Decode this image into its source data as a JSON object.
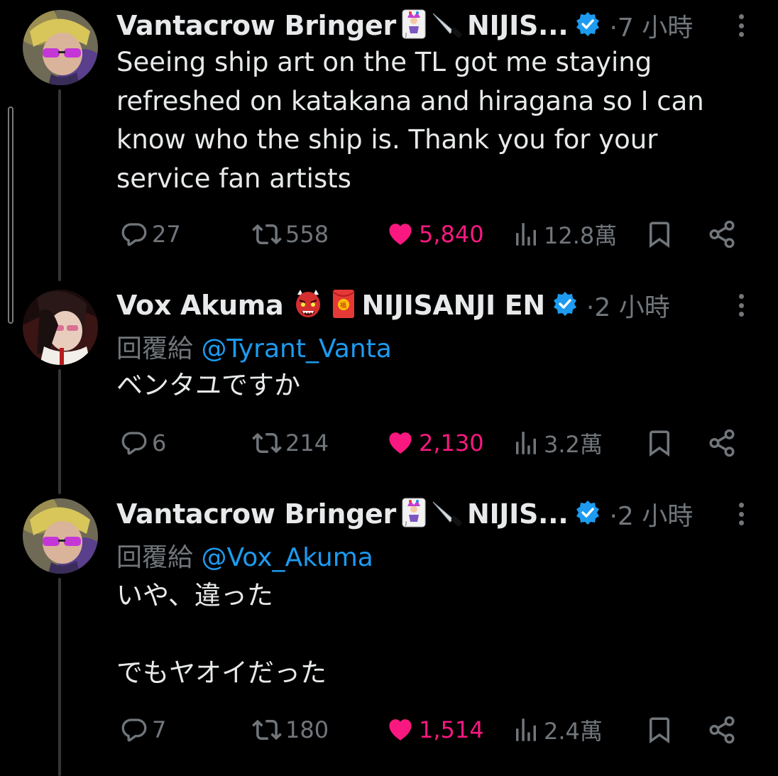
{
  "tweets": [
    {
      "display_name": "Vantacrow Bringer",
      "name_suffix": "NIJIS...",
      "time_sep": "·",
      "time": "7 小時",
      "reply_prefix": "",
      "reply_handle": "",
      "text": "Seeing ship art on the TL got me staying\nrefreshed on katakana and hiragana so I can\nknow who the ship is. Thank you for your\nservice fan artists",
      "replies": "27",
      "retweets": "558",
      "likes": "5,840",
      "views": "12.8萬"
    },
    {
      "display_name": "Vox Akuma",
      "name_suffix": "NIJISANJI EN",
      "time_sep": "·",
      "time": "2 小時",
      "reply_prefix": "回覆給",
      "reply_handle": "@Tyrant_Vanta",
      "text": "ベンタユですか",
      "replies": "6",
      "retweets": "214",
      "likes": "2,130",
      "views": "3.2萬"
    },
    {
      "display_name": "Vantacrow Bringer",
      "name_suffix": "NIJIS...",
      "time_sep": "·",
      "time": "2 小時",
      "reply_prefix": "回覆給",
      "reply_handle": "@Vox_Akuma",
      "text": "いや、違った\n\nでもヤオイだった",
      "replies": "7",
      "retweets": "180",
      "likes": "1,514",
      "views": "2.4萬"
    }
  ],
  "icons": {
    "verified": "verified-badge-icon",
    "reply": "reply-icon",
    "retweet": "retweet-icon",
    "like": "heart-icon",
    "views": "views-icon",
    "bookmark": "bookmark-icon",
    "share": "share-icon",
    "more": "more-icon",
    "emoji_joker": "joker-card-icon",
    "emoji_knife": "knife-icon",
    "emoji_oni": "oni-mask-icon",
    "emoji_envelope": "red-envelope-icon"
  },
  "colors": {
    "background": "#000000",
    "text": "#e7e9ea",
    "muted": "#71767b",
    "link": "#1d9bf0",
    "like": "#f91880",
    "verified": "#1d9bf0",
    "thread_line": "#333639"
  }
}
